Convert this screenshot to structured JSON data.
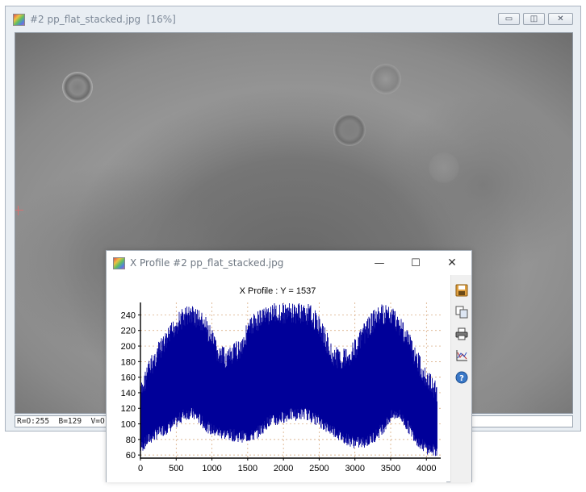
{
  "main_window": {
    "title": "#2 pp_flat_stacked.jpg  [16%]",
    "buttons": {
      "minimize": "▭",
      "restore": "◫",
      "close": "✕"
    },
    "status_text": "R=O:255  B=129  V=O"
  },
  "profile_window": {
    "title": "X Profile #2 pp_flat_stacked.jpg",
    "buttons": {
      "minimize": "—",
      "maximize": "☐",
      "close": "✕"
    },
    "toolbar_icons": [
      "save-icon",
      "copy-icon",
      "print-icon",
      "chart-settings-icon",
      "help-icon"
    ]
  },
  "chart_data": {
    "type": "area",
    "title": "X Profile :   Y = 1537",
    "xlabel": "",
    "ylabel": "",
    "xlim": [
      0,
      4200
    ],
    "ylim": [
      56,
      256
    ],
    "x_ticks": [
      "0",
      "500",
      "1000",
      "1500",
      "2000",
      "2500",
      "3000",
      "3500",
      "4000"
    ],
    "y_ticks": [
      "60",
      "80",
      "100",
      "120",
      "140",
      "160",
      "180",
      "200",
      "220",
      "240"
    ],
    "grid": true,
    "fill_color": "#000099",
    "series": [
      {
        "x": [
          0,
          100,
          250,
          400,
          500,
          600,
          700,
          800,
          900,
          1000,
          1100,
          1250,
          1400,
          1500,
          1600,
          1700,
          1800,
          1900,
          2000,
          2100,
          2200,
          2300,
          2400,
          2500,
          2600,
          2700,
          2800,
          2900,
          3000,
          3100,
          3200,
          3300,
          3400,
          3500,
          3600,
          3700,
          3800,
          3900,
          4000,
          4100,
          4150
        ],
        "upper": [
          150,
          180,
          205,
          225,
          242,
          250,
          255,
          250,
          240,
          222,
          200,
          198,
          212,
          232,
          245,
          250,
          255,
          256,
          256,
          256,
          256,
          256,
          252,
          240,
          220,
          200,
          198,
          200,
          210,
          225,
          240,
          250,
          255,
          253,
          245,
          230,
          210,
          190,
          172,
          160,
          152
        ],
        "lower": [
          65,
          75,
          85,
          92,
          98,
          108,
          110,
          105,
          95,
          88,
          85,
          82,
          80,
          80,
          82,
          90,
          100,
          100,
          105,
          108,
          108,
          110,
          105,
          100,
          92,
          88,
          80,
          76,
          72,
          72,
          75,
          82,
          92,
          105,
          110,
          98,
          85,
          72,
          65,
          62,
          62
        ]
      }
    ]
  }
}
